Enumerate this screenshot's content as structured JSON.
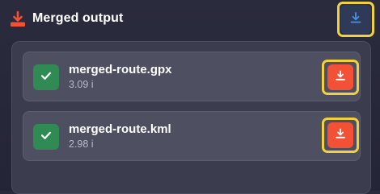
{
  "header": {
    "title": "Merged output",
    "icon": "download-tray-icon",
    "icon_color": "#f25136",
    "download_all_icon": "download-icon",
    "download_all_icon_color": "#4a90e2"
  },
  "files": [
    {
      "name": "merged-route.gpx",
      "size": "3.09 i",
      "status_icon": "checkmark-icon",
      "status_color": "#2f8a53",
      "download_icon": "download-icon",
      "download_color": "#f25136"
    },
    {
      "name": "merged-route.kml",
      "size": "2.98 i",
      "status_icon": "checkmark-icon",
      "status_color": "#2f8a53",
      "download_icon": "download-icon",
      "download_color": "#f25136"
    }
  ],
  "colors": {
    "highlight": "#f2d23a",
    "background": "#2a2b3d",
    "panel": "#3b3d4e",
    "card": "#4e5062"
  }
}
